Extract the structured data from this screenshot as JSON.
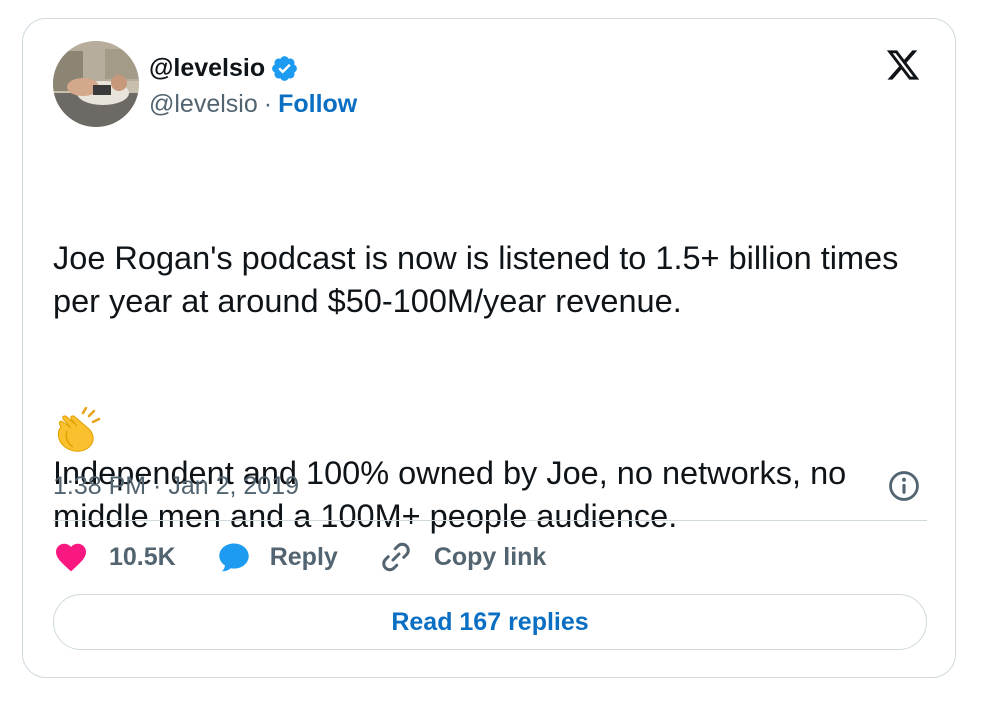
{
  "author": {
    "display_name": "@levelsio",
    "handle": "@levelsio",
    "separator": "·",
    "follow_label": "Follow",
    "verified_color": "#1d9bf0"
  },
  "tweet": {
    "paragraph_1": "Joe Rogan's podcast is now is listened to 1.5+ billion times per year at around $50-100M/year revenue.",
    "paragraph_2": "Independent and 100% owned by Joe, no networks, no middle men and a 100M+ people audience.",
    "emoji": "clapping-hands-icon",
    "timestamp": "1:38 PM · Jan 2, 2019"
  },
  "actions": {
    "like_count": "10.5K",
    "reply_label": "Reply",
    "copy_link_label": "Copy link"
  },
  "read_replies_label": "Read 167 replies",
  "colors": {
    "accent": "#0a6fc2",
    "heart": "#f91880",
    "reply_bubble": "#1d9bf0",
    "muted": "#536471",
    "text": "#0f1419",
    "border": "#cfd9de"
  }
}
